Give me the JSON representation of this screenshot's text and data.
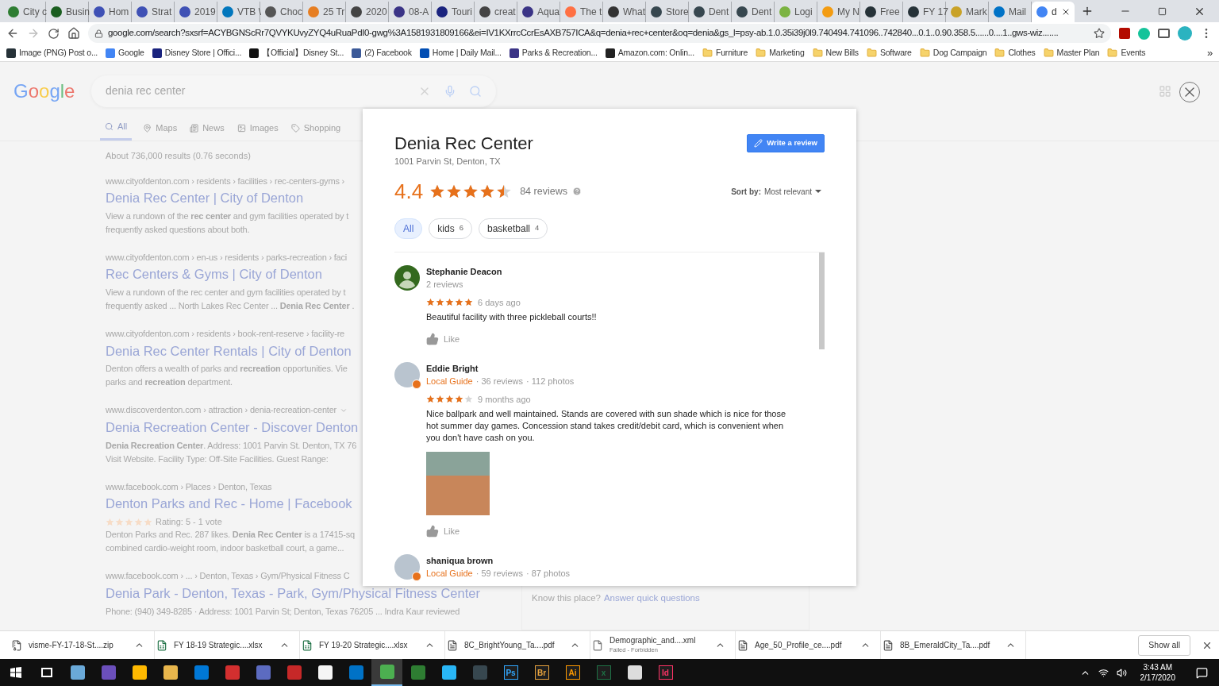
{
  "browser": {
    "tabs": [
      {
        "title": "City c",
        "color": "#2e7d32",
        "selected": false
      },
      {
        "title": "Busin",
        "color": "#1b5e20",
        "selected": false
      },
      {
        "title": "Hom",
        "color": "#3f51b5",
        "selected": false
      },
      {
        "title": "Strat",
        "color": "#3f51b5",
        "selected": false
      },
      {
        "title": "2019",
        "color": "#3f51b5",
        "selected": false
      },
      {
        "title": "VTB \\",
        "color": "#0277bd",
        "selected": false
      },
      {
        "title": "Choc",
        "color": "#555555",
        "selected": false
      },
      {
        "title": "25 Tr",
        "color": "#e67e22",
        "selected": false
      },
      {
        "title": "2020",
        "color": "#444444",
        "selected": false
      },
      {
        "title": "08-A",
        "color": "#3b3486",
        "selected": false
      },
      {
        "title": "Touri",
        "color": "#1a237e",
        "selected": false
      },
      {
        "title": "creat",
        "color": "#444444",
        "selected": false
      },
      {
        "title": "Aqua",
        "color": "#3b3486",
        "selected": false
      },
      {
        "title": "The t",
        "color": "#ff7043",
        "selected": false
      },
      {
        "title": "What",
        "color": "#333333",
        "selected": false
      },
      {
        "title": "Store",
        "color": "#37474f",
        "selected": false
      },
      {
        "title": "Dent",
        "color": "#37474f",
        "selected": false
      },
      {
        "title": "Dent",
        "color": "#37474f",
        "selected": false
      },
      {
        "title": "Logi",
        "color": "#7cb342",
        "selected": false
      },
      {
        "title": "My N",
        "color": "#f39c12",
        "selected": false
      },
      {
        "title": "Free",
        "color": "#263238",
        "selected": false
      },
      {
        "title": "FY 17",
        "color": "#263238",
        "selected": false
      },
      {
        "title": "Mark",
        "color": "#c9a227",
        "selected": false
      },
      {
        "title": "Mail",
        "color": "#0072c6",
        "selected": false
      },
      {
        "title": "d",
        "color": "#4285f4",
        "selected": true
      }
    ],
    "url": "google.com/search?sxsrf=ACYBGNScRr7QVYKUvyZYQ4uRuaPdI0-gwg%3A1581931809166&ei=IV1KXrrcCcrEsAXB757ICA&q=denia+rec+center&oq=denia&gs_l=psy-ab.1.0.35i39j0l9.740494.741096..742840...0.1..0.90.358.5......0....1..gws-wiz.......",
    "bookmarks": [
      {
        "kind": "site",
        "label": "Image (PNG) Post o...",
        "color": "#263238"
      },
      {
        "kind": "site",
        "label": "Google",
        "color": "#4285f4"
      },
      {
        "kind": "site",
        "label": "Disney Store | Offici...",
        "color": "#1a237e"
      },
      {
        "kind": "site",
        "label": "【Official】Disney St...",
        "color": "#111111"
      },
      {
        "kind": "site",
        "label": "(2) Facebook",
        "color": "#3b5998"
      },
      {
        "kind": "site",
        "label": "Home | Daily Mail...",
        "color": "#004db3"
      },
      {
        "kind": "site",
        "label": "Parks & Recreation...",
        "color": "#3b3486"
      },
      {
        "kind": "site",
        "label": "Amazon.com: Onlin...",
        "color": "#222222"
      },
      {
        "kind": "folder",
        "label": "Furniture"
      },
      {
        "kind": "folder",
        "label": "Marketing"
      },
      {
        "kind": "folder",
        "label": "New Bills"
      },
      {
        "kind": "folder",
        "label": "Software"
      },
      {
        "kind": "folder",
        "label": "Dog Campaign"
      },
      {
        "kind": "folder",
        "label": "Clothes"
      },
      {
        "kind": "folder",
        "label": "Master Plan"
      },
      {
        "kind": "folder",
        "label": "Events"
      }
    ],
    "more_bookmarks": "»"
  },
  "search_page": {
    "logo": "Google",
    "query": "denia rec center",
    "tabs": [
      {
        "label": "All",
        "selected": true
      },
      {
        "label": "Maps",
        "selected": false
      },
      {
        "label": "News",
        "selected": false
      },
      {
        "label": "Images",
        "selected": false
      },
      {
        "label": "Shopping",
        "selected": false
      }
    ],
    "stats": "About 736,000 results (0.76 seconds)",
    "results": [
      {
        "url": "www.cityofdenton.com › residents › facilities › rec-centers-gyms ›",
        "title": "Denia Rec Center | City of Denton",
        "snippet": [
          "View a rundown of the **rec center** and gym facilities operated by t",
          "frequently asked questions about both."
        ]
      },
      {
        "url": "www.cityofdenton.com › en-us › residents › parks-recreation › faci",
        "title": "Rec Centers & Gyms | City of Denton",
        "snippet": [
          "View a rundown of the rec center and gym facilities operated by t",
          "frequently asked ... North Lakes Rec Center ... **Denia Rec Center** ."
        ]
      },
      {
        "url": "www.cityofdenton.com › residents › book-rent-reserve › facility-re",
        "title": "Denia Rec Center Rentals | City of Denton",
        "snippet": [
          "Denton offers a wealth of parks and **recreation** opportunities. Vie",
          "parks and **recreation** department."
        ]
      },
      {
        "url": "www.discoverdenton.com › attraction › denia-recreation-center",
        "title": "Denia Recreation Center - Discover Denton",
        "snippet": [
          "**Denia Recreation Center**. Address: 1001 Parvin St. Denton, TX 76",
          "Visit Website. Facility Type: Off-Site Facilities. Guest Range:"
        ]
      },
      {
        "url": "www.facebook.com › Places › Denton, Texas",
        "title": "Denton Parks and Rec - Home | Facebook",
        "rating": {
          "stars": 5,
          "text": "Rating: 5 - 1 vote"
        },
        "snippet": [
          "Denton Parks and Rec. 287 likes. **Denia Rec Center** is a 17415-sq",
          "combined cardio-weight room, indoor basketball court, a game..."
        ]
      },
      {
        "url": "www.facebook.com › ... › Denton, Texas › Gym/Physical Fitness C",
        "title": "Denia Park - Denton, Texas - Park, Gym/Physical Fitness Center",
        "snippet": [
          "Phone: (940) 349-8285 · Address: 1001 Parvin St; Denton, Texas 76205 ... Indra Kaur reviewed"
        ]
      }
    ],
    "side_prompt": {
      "question": "Know this place?",
      "link": "Answer quick questions"
    }
  },
  "reviews_dialog": {
    "title": "Denia Rec Center",
    "address": "1001 Parvin St, Denton, TX",
    "write_button": "Write a review",
    "rating": "4.4",
    "stars": 4.5,
    "review_count": "84 reviews",
    "sort_label": "Sort by:",
    "sort_value": "Most relevant",
    "chips": [
      {
        "label": "All",
        "selected": true
      },
      {
        "label": "kids",
        "count": "6",
        "selected": false
      },
      {
        "label": "basketball",
        "count": "4",
        "selected": false
      }
    ],
    "reviews": [
      {
        "name": "Stephanie Deacon",
        "kind": "generic",
        "meta": [
          "2 reviews"
        ],
        "stars": 5,
        "when": "6 days ago",
        "text": "Beautiful facility with three pickleball courts!!",
        "like": "Like"
      },
      {
        "name": "Eddie Bright",
        "kind": "photo",
        "guide": "Local Guide",
        "meta": [
          "· 36 reviews",
          "· 112 photos"
        ],
        "stars": 4,
        "when": "9 months ago",
        "text": "Nice ballpark and well maintained. Stands are covered with sun shade which is nice for those hot summer day games. Concession stand takes credit/debit card, which is convenient when you don't have cash on you.",
        "photo": true,
        "like": "Like"
      },
      {
        "name": "shaniqua brown",
        "kind": "photo",
        "guide": "Local Guide",
        "meta": [
          "· 59 reviews",
          "· 87 photos"
        ]
      }
    ]
  },
  "downloads": {
    "items": [
      {
        "kind": "zip",
        "name": "visme-FY-17-18-St....zip"
      },
      {
        "kind": "excel",
        "name": "FY 18-19 Strategic....xlsx"
      },
      {
        "kind": "excel",
        "name": "FY 19-20 Strategic....xlsx"
      },
      {
        "kind": "pdf",
        "name": "8C_BrightYoung_Ta....pdf"
      },
      {
        "kind": "file",
        "name": "Demographic_and....xml",
        "status": "Failed - Forbidden"
      },
      {
        "kind": "pdf",
        "name": "Age_50_Profile_ce....pdf"
      },
      {
        "kind": "pdf",
        "name": "8B_EmeraldCity_Ta....pdf"
      }
    ],
    "show_all": "Show all"
  },
  "taskbar": {
    "apps": [
      {
        "kind": "icon",
        "color": "#6aa9d8",
        "selected": false
      },
      {
        "kind": "icon",
        "color": "#6b4fbb",
        "selected": false
      },
      {
        "kind": "icon",
        "color": "#ffb900",
        "selected": false
      },
      {
        "kind": "icon",
        "color": "#e8b64c",
        "selected": false
      },
      {
        "kind": "icon",
        "color": "#0078d7",
        "selected": false
      },
      {
        "kind": "icon",
        "color": "#d32f2f",
        "selected": false
      },
      {
        "kind": "icon",
        "color": "#5c6bc0",
        "selected": false
      },
      {
        "kind": "icon",
        "color": "#c62828",
        "selected": false
      },
      {
        "kind": "icon",
        "color": "#f5f5f5",
        "selected": false
      },
      {
        "kind": "icon",
        "color": "#0072c6",
        "selected": false
      },
      {
        "kind": "icon",
        "color": "#4caf50",
        "selected": true
      },
      {
        "kind": "icon",
        "color": "#2e7d32",
        "selected": false
      },
      {
        "kind": "icon",
        "color": "#29b6f6",
        "selected": false
      },
      {
        "kind": "icon",
        "color": "#37474f",
        "selected": false
      },
      {
        "kind": "label",
        "label": "Ps",
        "color": "#31a8ff",
        "selected": false
      },
      {
        "kind": "label",
        "label": "Br",
        "color": "#e8a33d",
        "selected": false
      },
      {
        "kind": "label",
        "label": "Ai",
        "color": "#ff9a00",
        "selected": false
      },
      {
        "kind": "label",
        "label": "x",
        "color": "#1e7145",
        "selected": false
      },
      {
        "kind": "icon",
        "color": "#dddddd",
        "selected": false
      },
      {
        "kind": "label",
        "label": "Id",
        "color": "#ff3366",
        "selected": false
      }
    ],
    "time": "3:43 AM",
    "date": "2/17/2020"
  }
}
